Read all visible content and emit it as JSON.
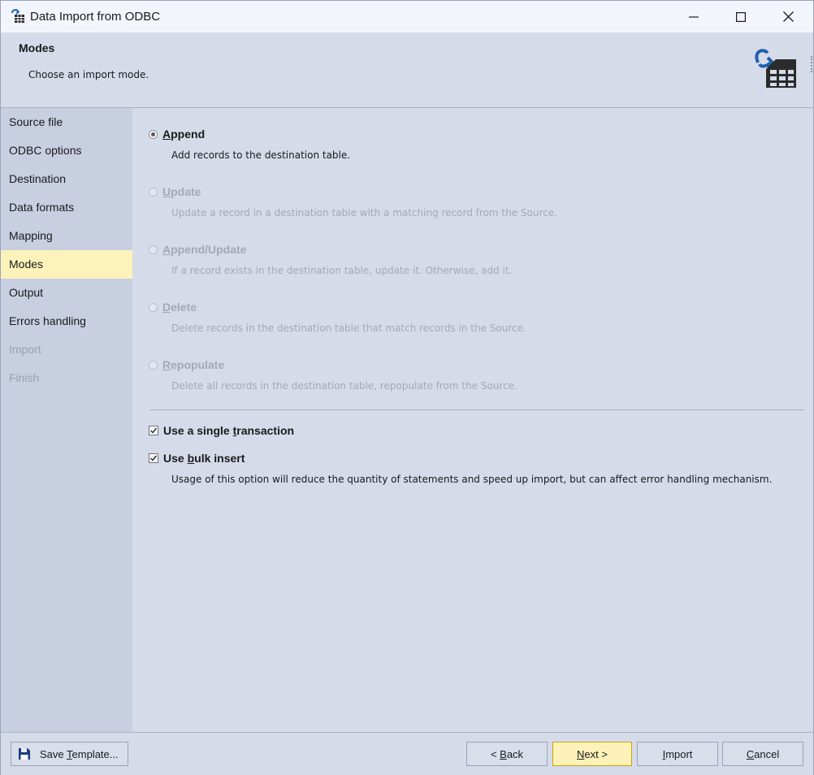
{
  "window": {
    "title": "Data Import from ODBC",
    "controls": [
      "minimize-icon",
      "maximize-icon",
      "close-icon"
    ]
  },
  "header": {
    "title": "Modes",
    "subtitle": "Choose an import mode.",
    "icon": "import-table-icon"
  },
  "sidebar": {
    "items": [
      {
        "label": "Source file",
        "state": "normal"
      },
      {
        "label": "ODBC options",
        "state": "normal"
      },
      {
        "label": "Destination",
        "state": "normal"
      },
      {
        "label": "Data formats",
        "state": "normal"
      },
      {
        "label": "Mapping",
        "state": "normal"
      },
      {
        "label": "Modes",
        "state": "active"
      },
      {
        "label": "Output",
        "state": "normal"
      },
      {
        "label": "Errors handling",
        "state": "normal"
      },
      {
        "label": "Import",
        "state": "disabled"
      },
      {
        "label": "Finish",
        "state": "disabled"
      }
    ]
  },
  "modes": [
    {
      "label_u": "A",
      "label_rest": "ppend",
      "desc": "Add records to the destination table.",
      "checked": true,
      "enabled": true
    },
    {
      "label_u": "U",
      "label_rest": "pdate",
      "desc": "Update a record in a destination table with a matching record from the Source.",
      "checked": false,
      "enabled": false
    },
    {
      "label_u": "A",
      "label_rest": "ppend/Update",
      "desc": "If a record exists in the destination table, update it. Otherwise, add it.",
      "checked": false,
      "enabled": false
    },
    {
      "label_u": "D",
      "label_rest": "elete",
      "desc": "Delete records in the destination table that match records in the Source.",
      "checked": false,
      "enabled": false
    },
    {
      "label_u": "R",
      "label_rest": "epopulate",
      "desc": "Delete all records in the destination table, repopulate from the Source.",
      "checked": false,
      "enabled": false
    }
  ],
  "options": {
    "single_transaction": {
      "pre": "Use a single ",
      "u": "t",
      "post": "ransaction",
      "checked": true
    },
    "bulk_insert": {
      "pre": "Use ",
      "u": "b",
      "post": "ulk insert",
      "checked": true,
      "desc": "Usage of this option will reduce the quantity of statements and speed up import, but can affect error handling mechanism."
    }
  },
  "footer": {
    "save_template": {
      "pre": "Save ",
      "u": "T",
      "post": "emplate...",
      "icon": "floppy-disk-icon"
    },
    "back": {
      "pre": "< ",
      "u": "B",
      "post": "ack"
    },
    "next": {
      "pre": "",
      "u": "N",
      "post": "ext >"
    },
    "import": {
      "pre": "",
      "u": "I",
      "post": "mport"
    },
    "cancel": {
      "pre": "",
      "u": "C",
      "post": "ancel"
    }
  },
  "colors": {
    "accent": "#fdf2b9",
    "panel": "#d5dbe9",
    "sidebar": "#c7cfe1",
    "icon_blue": "#1f5fb0",
    "icon_dark": "#2b2b2b"
  }
}
